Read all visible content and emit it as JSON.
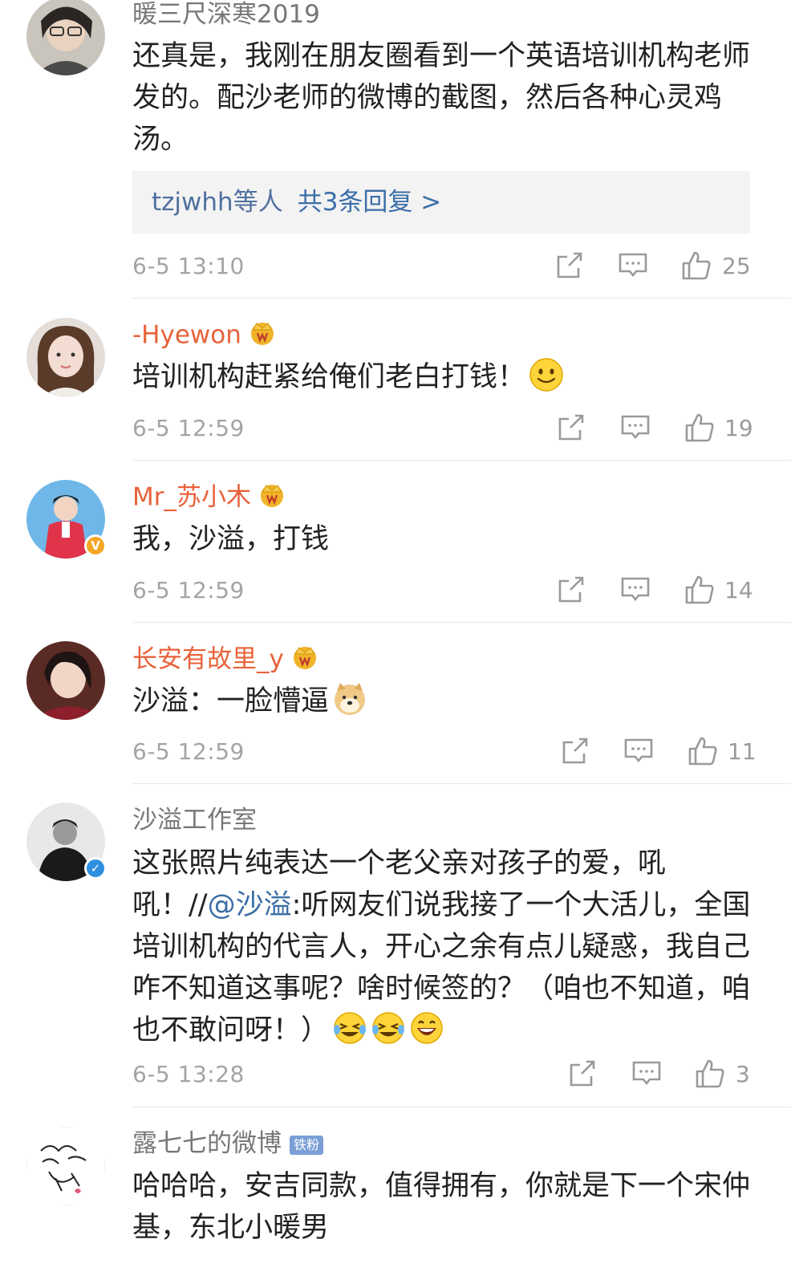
{
  "comments": [
    {
      "username": "暖三尺深寒2019",
      "text": "还真是，我刚在朋友圈看到一个英语培训机构老师发的。配沙老师的微博的截图，然后各种心灵鸡汤。",
      "replies": {
        "who": "tzjwhh等人",
        "count": "共3条回复 >"
      },
      "time": "6-5 13:10",
      "likes": "25"
    },
    {
      "username": "-Hyewon",
      "text": "培训机构赶紧给俺们老白打钱！",
      "time": "6-5 12:59",
      "likes": "19"
    },
    {
      "username": "Mr_苏小木",
      "text": "我，沙溢，打钱",
      "time": "6-5 12:59",
      "likes": "14"
    },
    {
      "username": "长安有故里_y",
      "text": "沙溢：一脸懵逼",
      "time": "6-5 12:59",
      "likes": "11"
    },
    {
      "username": "沙溢工作室",
      "text_a": "这张照片纯表达一个老父亲对孩子的爱，吼吼！//",
      "mention": "@沙溢",
      "text_b": ":听网友们说我接了一个大活儿，全国培训机构的代言人，开心之余有点儿疑惑，我自己咋不知道这事呢？啥时候签的？（咱也不知道，咱也不敢问呀！）",
      "time": "6-5 13:28",
      "likes": "3"
    },
    {
      "username": "露七七的微博",
      "badge": "铁粉",
      "text": "哈哈哈，安吉同款，值得拥有，你就是下一个宋仲基，东北小暖男"
    }
  ],
  "colors": {
    "vip_name": "#e8623a",
    "normal_name": "#777777",
    "link": "#3b6ea8",
    "time": "#a4a4a4",
    "icon": "#9a9a9a",
    "verified": "#2d8fe0",
    "verified_gold": "#f5a623",
    "crown": "#f0b429"
  }
}
